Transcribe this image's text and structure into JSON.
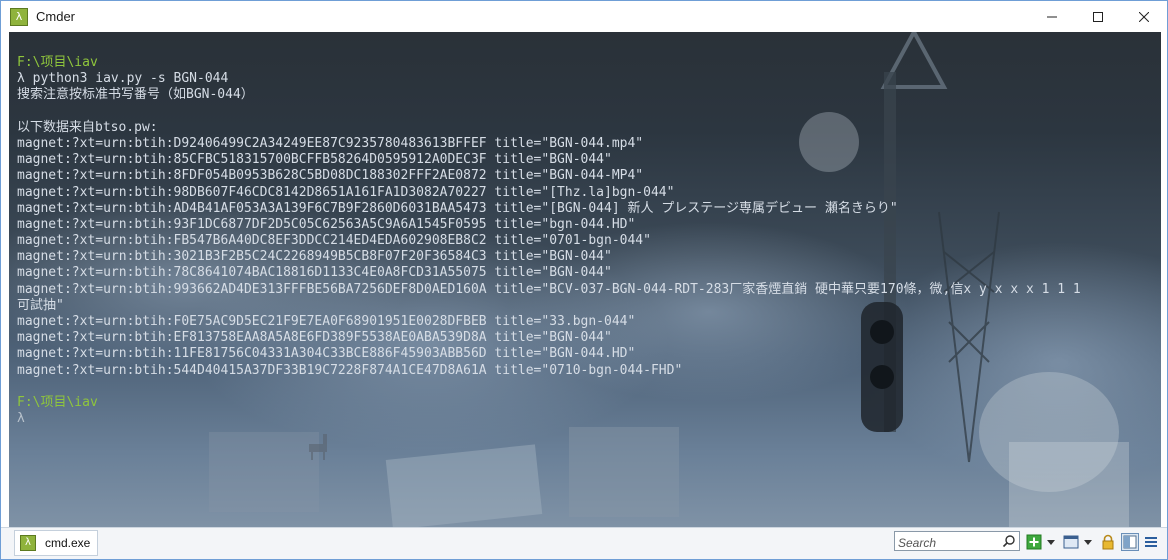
{
  "window": {
    "title": "Cmder",
    "app_icon_glyph": "λ"
  },
  "console": {
    "lines": [
      {
        "text": "F:\\项目\\iav",
        "kind": "prompt"
      },
      {
        "text": "λ python3 iav.py -s BGN-044",
        "kind": "command"
      },
      {
        "text": "搜索注意按标准书写番号（如BGN-044）",
        "kind": "output"
      },
      {
        "text": "",
        "kind": "blank"
      },
      {
        "text": "以下数据来自btso.pw:",
        "kind": "output"
      },
      {
        "text": "magnet:?xt=urn:btih:D92406499C2A34249EE87C9235780483613BFFEF title=\"BGN-044.mp4\"",
        "kind": "output"
      },
      {
        "text": "magnet:?xt=urn:btih:85CFBC518315700BCFFB58264D0595912A0DEC3F title=\"BGN-044\"",
        "kind": "output"
      },
      {
        "text": "magnet:?xt=urn:btih:8FDF054B0953B628C5BD08DC188302FFF2AE0872 title=\"BGN-044-MP4\"",
        "kind": "output"
      },
      {
        "text": "magnet:?xt=urn:btih:98DB607F46CDC8142D8651A161FA1D3082A70227 title=\"[Thz.la]bgn-044\"",
        "kind": "output"
      },
      {
        "text": "magnet:?xt=urn:btih:AD4B41AF053A3A139F6C7B9F2860D6031BAA5473 title=\"[BGN-044] 新人 プレステージ専属デビュー 瀬名きらり\"",
        "kind": "output"
      },
      {
        "text": "magnet:?xt=urn:btih:93F1DC6877DF2D5C05C62563A5C9A6A1545F0595 title=\"bgn-044.HD\"",
        "kind": "output"
      },
      {
        "text": "magnet:?xt=urn:btih:FB547B6A40DC8EF3DDCC214ED4EDA602908EB8C2 title=\"0701-bgn-044\"",
        "kind": "output"
      },
      {
        "text": "magnet:?xt=urn:btih:3021B3F2B5C24C2268949B5CB8F07F20F36584C3 title=\"BGN-044\"",
        "kind": "output"
      },
      {
        "text": "magnet:?xt=urn:btih:78C8641074BAC18816D1133C4E0A8FCD31A55075 title=\"BGN-044\"",
        "kind": "output"
      },
      {
        "text": "magnet:?xt=urn:btih:993662AD4DE313FFFBE56BA7256DEF8D0AED160A title=\"BCV-037-BGN-044-RDT-283厂家香煙直銷 硬中華只要170條，微,信x y x x x 1 1 1",
        "kind": "output"
      },
      {
        "text": "可試抽\"",
        "kind": "output"
      },
      {
        "text": "magnet:?xt=urn:btih:F0E75AC9D5EC21F9E7EA0F68901951E0028DFBEB title=\"33.bgn-044\"",
        "kind": "output"
      },
      {
        "text": "magnet:?xt=urn:btih:EF813758EAA8A5A8E6FD389F5538AE0ABA539D8A title=\"BGN-044\"",
        "kind": "output"
      },
      {
        "text": "magnet:?xt=urn:btih:11FE81756C04331A304C33BCE886F45903ABB56D title=\"BGN-044.HD\"",
        "kind": "output"
      },
      {
        "text": "magnet:?xt=urn:btih:544D40415A37DF33B19C7228F874A1CE47D8A61A title=\"0710-bgn-044-FHD\"",
        "kind": "output"
      },
      {
        "text": "",
        "kind": "blank"
      },
      {
        "text": "F:\\项目\\iav",
        "kind": "prompt"
      },
      {
        "text": "λ",
        "kind": "lambda"
      }
    ]
  },
  "tabbar": {
    "tab_label": "cmd.exe",
    "search_placeholder": "Search"
  },
  "icons": {
    "minimize": "minimize-icon",
    "maximize": "maximize-icon",
    "close": "close-icon",
    "search": "search-icon",
    "new_console": "plus-icon",
    "console_list": "window-icon",
    "lock": "lock-icon",
    "split": "split-view-icon",
    "menu": "hamburger-menu-icon"
  },
  "colors": {
    "prompt": "#8fc63c",
    "text": "#d6dde6",
    "accent": "#8fb33c"
  }
}
